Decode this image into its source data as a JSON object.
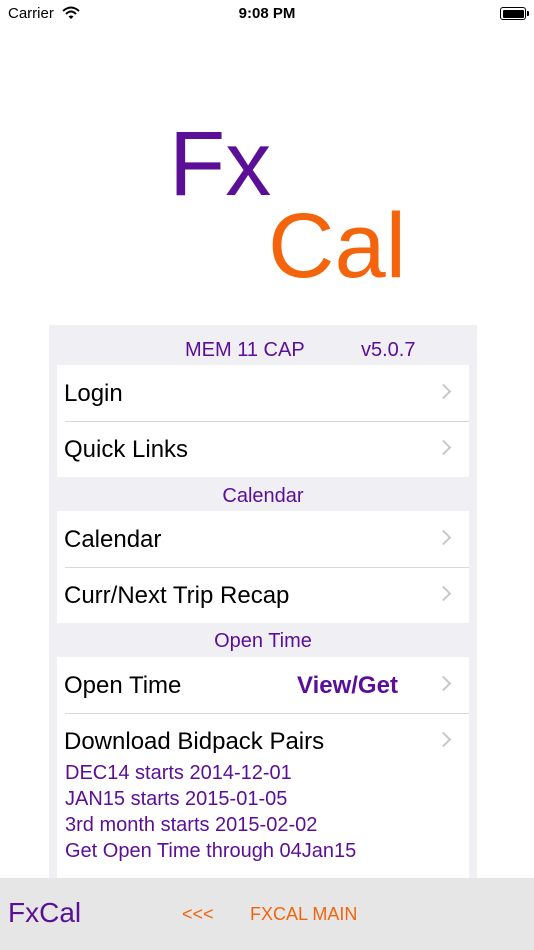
{
  "status_bar": {
    "carrier": "Carrier",
    "time": "9:08 PM",
    "icons": [
      "wifi-icon",
      "battery-icon"
    ]
  },
  "logo": {
    "line1": "Fx",
    "line2": "Cal",
    "color1": "#5b0e96",
    "color2": "#f4640c"
  },
  "header": {
    "title": "MEM 11 CAP",
    "version": "v5.0.7"
  },
  "groups": [
    {
      "section": "",
      "rows": [
        {
          "label": "Login"
        },
        {
          "label": "Quick Links"
        }
      ]
    },
    {
      "section": "Calendar",
      "rows": [
        {
          "label": "Calendar"
        },
        {
          "label": "Curr/Next Trip Recap"
        }
      ]
    },
    {
      "section": "Open Time",
      "rows": [
        {
          "label": "Open Time",
          "value": "View/Get"
        },
        {
          "label": "Download Bidpack Pairs"
        }
      ]
    }
  ],
  "info_lines": [
    "DEC14 starts 2014-12-01",
    "JAN15 starts 2015-01-05",
    "3rd month starts 2015-02-02",
    "Get Open Time through 04Jan15"
  ],
  "bottom_bar": {
    "app_name": "FxCal",
    "back_label": "<<<",
    "main_label": "FXCAL MAIN"
  },
  "colors": {
    "purple": "#5b0e96",
    "orange": "#f4640c",
    "panel_bg": "#efeff4"
  }
}
